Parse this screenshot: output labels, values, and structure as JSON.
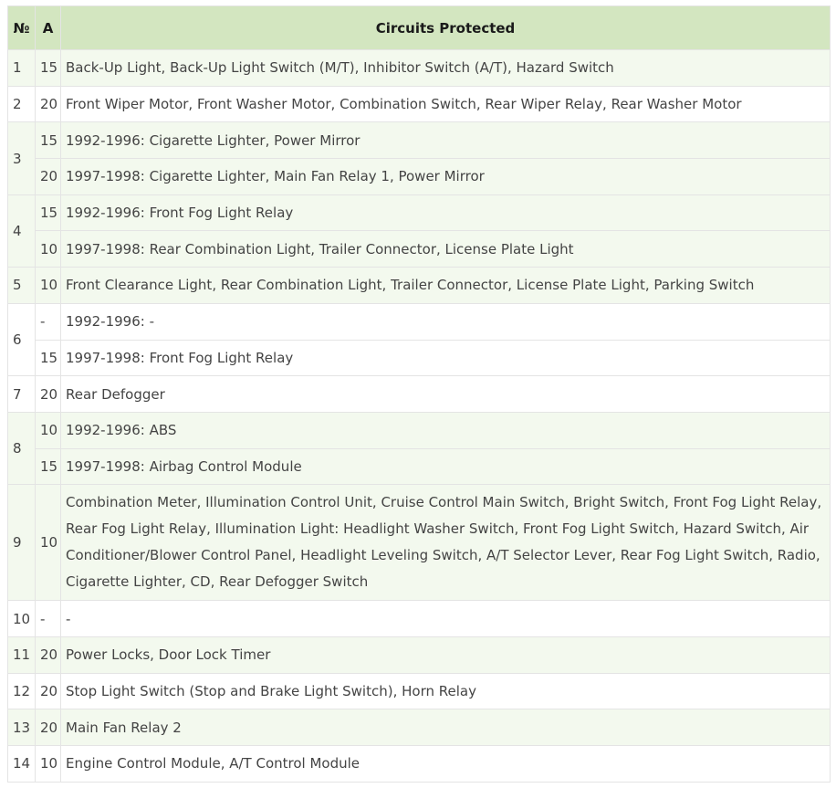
{
  "table": {
    "headers": {
      "no": "№",
      "amp": "A",
      "circuits": "Circuits Protected"
    },
    "rows": [
      {
        "no": "1",
        "band": "green",
        "entries": [
          {
            "amp": "15",
            "text": "Back-Up Light, Back-Up Light Switch (M/T), Inhibitor Switch (A/T), Hazard Switch"
          }
        ]
      },
      {
        "no": "2",
        "band": "white",
        "entries": [
          {
            "amp": "20",
            "text": "Front Wiper Motor, Front Washer Motor, Combination Switch, Rear Wiper Relay, Rear Washer Motor"
          }
        ]
      },
      {
        "no": "3",
        "band": "green",
        "entries": [
          {
            "amp": "15",
            "text": "1992-1996: Cigarette Lighter, Power Mirror"
          },
          {
            "amp": "20",
            "text": "1997-1998: Cigarette Lighter, Main Fan Relay 1, Power Mirror"
          }
        ]
      },
      {
        "no": "4",
        "band": "green",
        "entries": [
          {
            "amp": "15",
            "text": "1992-1996: Front Fog Light Relay"
          },
          {
            "amp": "10",
            "text": "1997-1998: Rear Combination Light, Trailer Connector, License Plate Light"
          }
        ]
      },
      {
        "no": "5",
        "band": "green",
        "entries": [
          {
            "amp": "10",
            "text": "Front Clearance Light, Rear Combination Light, Trailer Connector, License Plate Light, Parking Switch"
          }
        ]
      },
      {
        "no": "6",
        "band": "white",
        "entries": [
          {
            "amp": "-",
            "text": "1992-1996:  -"
          },
          {
            "amp": "15",
            "text": "1997-1998: Front Fog Light Relay"
          }
        ]
      },
      {
        "no": "7",
        "band": "white",
        "entries": [
          {
            "amp": "20",
            "text": "Rear Defogger"
          }
        ]
      },
      {
        "no": "8",
        "band": "green",
        "entries": [
          {
            "amp": "10",
            "text": "1992-1996: ABS"
          },
          {
            "amp": "15",
            "text": "1997-1998: Airbag Control Module"
          }
        ]
      },
      {
        "no": "9",
        "band": "green",
        "entries": [
          {
            "amp": "10",
            "text": "Combination Meter, Illumination Control Unit, Cruise Control Main Switch, Bright Switch, Front Fog Light Relay, Rear Fog Light Relay, Illumination Light: Headlight Washer Switch, Front Fog Light Switch, Hazard Switch, Air Conditioner/Blower Control Panel, Headlight Leveling Switch, A/T Selector Lever, Rear Fog Light Switch, Radio, Cigarette Lighter, CD, Rear Defogger Switch"
          }
        ]
      },
      {
        "no": "10",
        "band": "white",
        "entries": [
          {
            "amp": "-",
            "text": "-"
          }
        ]
      },
      {
        "no": "11",
        "band": "green",
        "entries": [
          {
            "amp": "20",
            "text": "Power Locks, Door Lock Timer"
          }
        ]
      },
      {
        "no": "12",
        "band": "white",
        "entries": [
          {
            "amp": "20",
            "text": "Stop Light Switch (Stop and Brake Light Switch), Horn Relay"
          }
        ]
      },
      {
        "no": "13",
        "band": "green",
        "entries": [
          {
            "amp": "20",
            "text": "Main Fan Relay 2"
          }
        ]
      },
      {
        "no": "14",
        "band": "white",
        "entries": [
          {
            "amp": "10",
            "text": "Engine Control Module, A/T Control Module"
          }
        ]
      }
    ]
  },
  "colors": {
    "header_bg": "#d3e6c0",
    "band_green": "#f3f9ee",
    "band_white": "#ffffff",
    "border": "#e4e4e4"
  }
}
